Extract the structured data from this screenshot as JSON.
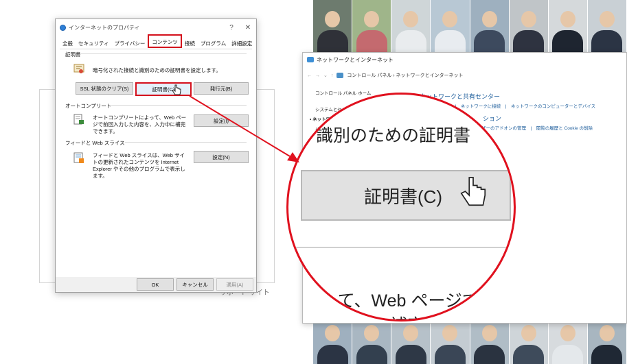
{
  "photos": {
    "top": [
      "p1",
      "p2",
      "p3",
      "p4",
      "p5",
      "p6",
      "p7",
      "p8"
    ],
    "bottom": [
      "q1",
      "q2",
      "q3",
      "q4",
      "q5",
      "q6",
      "q7",
      "q8"
    ]
  },
  "ghost": {
    "footer": "サポート サイト"
  },
  "props": {
    "title": "インターネットのプロパティ",
    "help": "?",
    "close": "✕",
    "tabs": [
      "全般",
      "セキュリティ",
      "プライバシー",
      "コンテンツ",
      "接続",
      "プログラム",
      "詳細設定"
    ],
    "cert_group": "証明書",
    "cert_desc": "暗号化された接続と識別のための証明書を設定します。",
    "btn_ssl": "SSL 状態のクリア(S)",
    "btn_cert": "証明書(C)",
    "btn_pub": "発行元(B)",
    "ac_group": "オートコンプリート",
    "ac_desc": "オートコンプリートによって、Web ページで前回入力した内容を、入力中に補完できます。",
    "btn_ac": "設定(I)",
    "feed_group": "フィードと Web スライス",
    "feed_desc": "フィードと Web スライスは、Web サイトの更新されたコンテンツを Internet Explorer やその他のプログラムで表示します。",
    "btn_feed": "設定(N)",
    "ok": "OK",
    "cancel": "キャンセル",
    "apply": "適用(A)"
  },
  "net": {
    "title": "ネットワークとインターネット",
    "breadcrumb": "コントロール パネル  ›  ネットワークとインターネット",
    "side1": "コントロール パネル ホーム",
    "side2": "システムとセキュリティ",
    "side3": "ネットワーク",
    "side4": "ハー",
    "heading": "ネットワークと共有センター",
    "links": "の状態とタスクの表示　|　ネットワークに接続　|　ネットワークのコンピューターとデバイス",
    "options": "ション",
    "links2": "ザーのアドオンの管理　|　閲覧の履歴と Cookie の削除"
  },
  "magnifier": {
    "heading": "識別のための証明書",
    "button": "証明書(C)",
    "body1": "って、Web ページで前",
    "body2": "入力中に補完で"
  }
}
